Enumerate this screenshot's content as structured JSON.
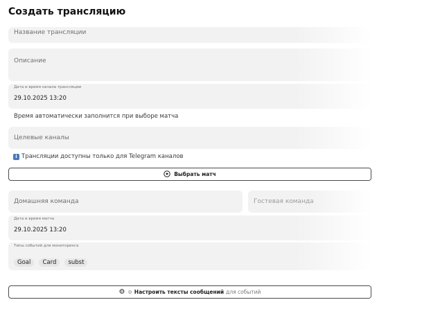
{
  "page": {
    "title": "Создать трансляцию"
  },
  "form": {
    "name_placeholder": "Название трансляции",
    "description_placeholder": "Описание",
    "start_label": "Дата и время начала трансляции",
    "start_value": "29.10.2025 13:20",
    "auto_time_hint": "Время автоматически заполнится при выборе матча",
    "channels_placeholder": "Целевые каналы",
    "telegram_hint": "Трансляции доступны только для Telegram каналов"
  },
  "select_match_button": {
    "label": "Выбрать матч",
    "icon": "soccer-ball-icon"
  },
  "match": {
    "home_team_placeholder": "Домашняя команда",
    "away_team_placeholder": "Гостевая команда",
    "match_datetime_label": "Дата и время матча",
    "match_datetime_value": "29.10.2025 13:20",
    "event_types_label": "Типы событий для мониторинга",
    "event_types": [
      "Goal",
      "Card",
      "subst"
    ]
  },
  "configure_button": {
    "label_main": "Настроить тексты сообщений",
    "label_muted": "для событий",
    "icon": "gear-icon"
  },
  "colors": {
    "field_bg": "#f2f2f2",
    "info_icon": "#4a78b8",
    "button_border": "#4a4a4a"
  }
}
